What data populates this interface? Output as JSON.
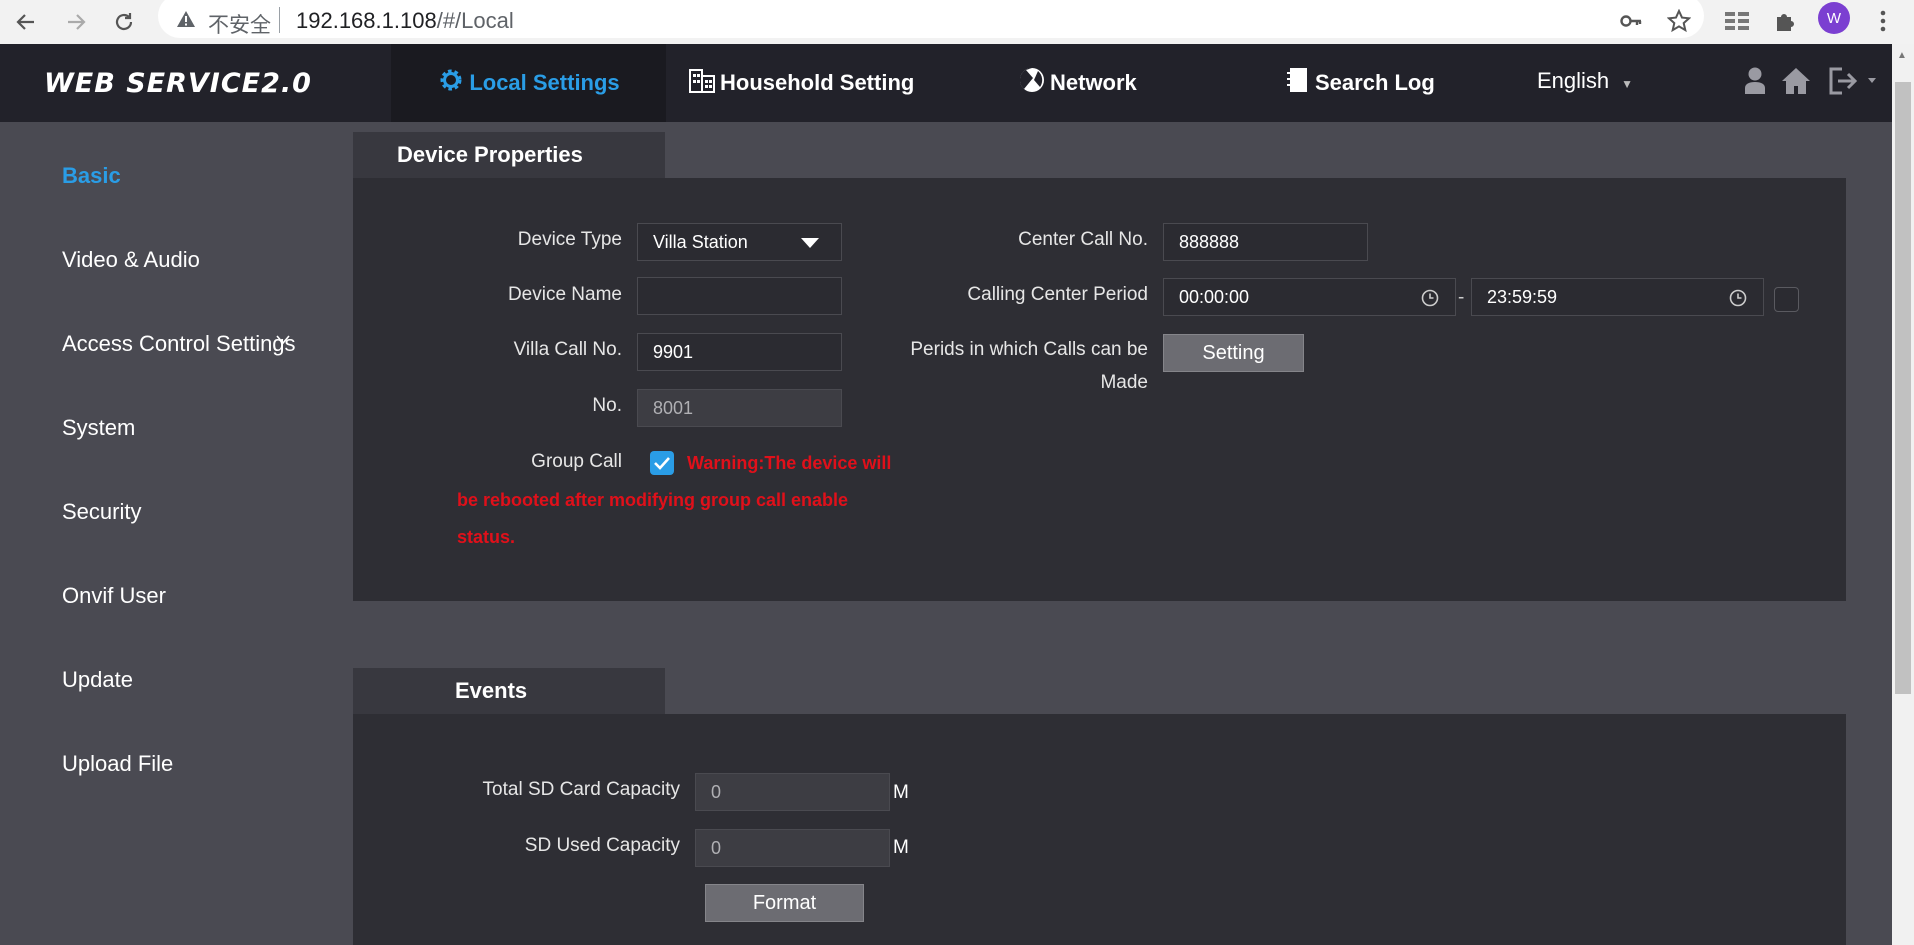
{
  "browser": {
    "insecure_label": "不安全",
    "url_host": "192.168.1.108",
    "url_path": "/#/Local",
    "profile_initial": "W"
  },
  "header": {
    "logo": "WEB SERVICE2.0",
    "tabs": [
      {
        "label": "Local Settings",
        "icon": "gear-icon"
      },
      {
        "label": "Household Setting",
        "icon": "building-icon"
      },
      {
        "label": "Network",
        "icon": "globe-icon"
      },
      {
        "label": "Search Log",
        "icon": "log-icon"
      }
    ],
    "language": "English"
  },
  "sidebar": {
    "items": [
      {
        "label": "Basic"
      },
      {
        "label": "Video & Audio"
      },
      {
        "label": "Access Control Settings"
      },
      {
        "label": "System"
      },
      {
        "label": "Security"
      },
      {
        "label": "Onvif User"
      },
      {
        "label": "Update"
      },
      {
        "label": "Upload File"
      }
    ]
  },
  "device_properties": {
    "title": "Device Properties",
    "device_type_label": "Device Type",
    "device_type_value": "Villa Station",
    "device_name_label": "Device Name",
    "device_name_value": "",
    "villa_call_label": "Villa Call No.",
    "villa_call_value": "9901",
    "no_label": "No.",
    "no_value": "8001",
    "group_call_label": "Group Call",
    "group_call_checked": true,
    "warning_line1": "Warning:The device will",
    "warning_line2": "be rebooted after modifying group call enable",
    "warning_line3": "status.",
    "center_call_label": "Center Call No.",
    "center_call_value": "888888",
    "calling_period_label": "Calling Center Period",
    "period_start": "00:00:00",
    "period_sep": "-",
    "period_end": "23:59:59",
    "periods_label_line1": "Perids in which Calls can be",
    "periods_label_line2": "Made",
    "setting_button": "Setting"
  },
  "events": {
    "title": "Events",
    "total_sd_label": "Total SD Card Capacity",
    "total_sd_value": "0",
    "used_sd_label": "SD Used Capacity",
    "used_sd_value": "0",
    "unit": "M",
    "format_button": "Format"
  },
  "colors": {
    "accent": "#2a9de6",
    "warning": "#e0101a",
    "header_bg": "#22222a",
    "panel_bg": "#2e2e34",
    "page_bg": "#4a4a52"
  }
}
